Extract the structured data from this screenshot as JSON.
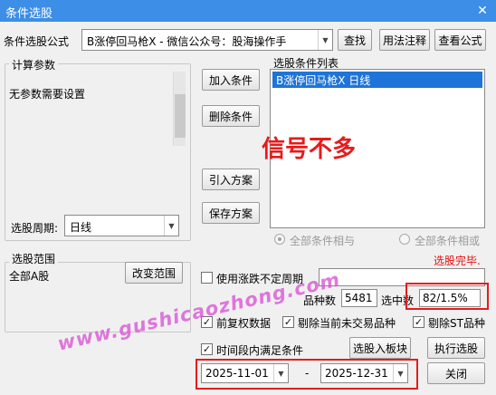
{
  "window": {
    "title": "条件选股",
    "close_glyph": "✕"
  },
  "formula_row": {
    "label": "条件选股公式",
    "selected": "B涨停回马枪X  -  微信公众号：股海操作手",
    "find_button": "查找",
    "usage_button": "用法注释",
    "view_button": "查看公式"
  },
  "params": {
    "group_label": "计算参数",
    "message": "无参数需要设置",
    "period_label": "选股周期:",
    "period_value": "日线"
  },
  "actions": {
    "add": "加入条件",
    "delete": "删除条件",
    "import": "引入方案",
    "save": "保存方案"
  },
  "conditions": {
    "label": "选股条件列表",
    "items": [
      "B涨停回马枪X  日线"
    ],
    "overlay_text": "信号不多"
  },
  "logic": {
    "and_label": "全部条件相与",
    "or_label": "全部条件相或"
  },
  "status_text": "选股完毕.",
  "range": {
    "group_label": "选股范围",
    "value": "全部A股",
    "change_button": "改变范围"
  },
  "options": {
    "uncertain_period": "使用涨跌不定周期",
    "forward_adj": "前复权数据",
    "exclude_untraded": "剔除当前未交易品种",
    "exclude_st": "剔除ST品种",
    "time_range": "时间段内满足条件"
  },
  "stats": {
    "count_label": "品种数",
    "count_value": "5481",
    "selected_label": "选中数",
    "selected_value": "82/1.5%"
  },
  "buttons": {
    "to_block": "选股入板块",
    "execute": "执行选股",
    "close": "关闭"
  },
  "dates": {
    "start": "2025-11-01",
    "separator": "-",
    "end": "2025-12-31"
  },
  "watermark": "www.gushicaozhong.com",
  "colors": {
    "title_bar": "#3c8ee6",
    "selection": "#1e74d8",
    "overlay_text": "#e61b1b",
    "status": "#e01010",
    "highlight_box": "#e51c1c",
    "watermark": "#d94cd4"
  }
}
